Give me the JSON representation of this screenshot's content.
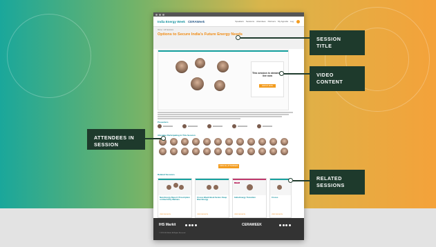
{
  "browser": {
    "url": ""
  },
  "site": {
    "logo_left": "India Energy Week",
    "logo_right": "CERAWeek",
    "nav": [
      "Speakers",
      "Sessions",
      "Attendees",
      "Partners",
      "My Agenda",
      "Log"
    ]
  },
  "session": {
    "breadcrumb": "Home > All Sessions",
    "title": "Options to Secure India's Future Energy Needs",
    "stream_text": "This session is streaming live now",
    "stream_button": "WATCH NOW"
  },
  "sections": {
    "presenters": "Presenters",
    "attendees": "Attendee Participating In This Session",
    "view_all": "VIEW ALL ATTENDEES",
    "related": "Related Sessions"
  },
  "related_sessions": [
    {
      "title": "New Energy Report: Prescription on Electricity Markets",
      "link": "VIEW SESSION",
      "accent": "#16a2a0"
    },
    {
      "title": "Crosss Black Book Series: Deep Dive Energy",
      "link": "VIEW SESSION",
      "accent": "#16a2a0"
    },
    {
      "title": "India Energy Transition",
      "link": "VIEW SESSION",
      "accent": "#c0396d",
      "badge": "LIVE"
    },
    {
      "title": "Crosss",
      "link": "VIEW SESSION",
      "accent": "#16a2a0"
    }
  ],
  "footer": {
    "left_brand": "IHS Markit",
    "right_brand": "CERAWEEK",
    "copyright": "© 2020 IHS Markit. All Rights Reserved."
  },
  "callouts": {
    "session_title": "SESSION TITLE",
    "video_content": "VIDEO CONTENT",
    "attendees": "ATTENDEES IN SESSION",
    "related": "RELATED SESSIONS"
  },
  "colors": {
    "accent_orange": "#f39c1f",
    "accent_teal": "#16a2a0",
    "callout_bg": "#1e3a2c"
  }
}
